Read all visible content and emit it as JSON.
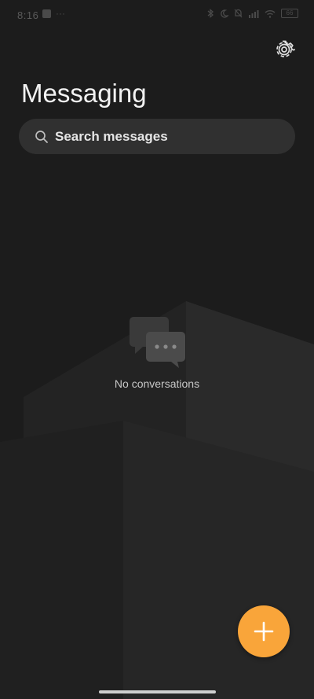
{
  "status_bar": {
    "time": "8:16",
    "battery": "66"
  },
  "header": {
    "title": "Messaging"
  },
  "search": {
    "label": "Search messages"
  },
  "empty_state": {
    "text": "No conversations"
  },
  "icons": {
    "settings": "gear-icon",
    "search": "search-icon",
    "empty": "chat-bubbles-icon",
    "fab": "plus-icon"
  },
  "colors": {
    "background": "#1c1c1c",
    "search_bg": "#303030",
    "accent": "#f9a53a"
  }
}
